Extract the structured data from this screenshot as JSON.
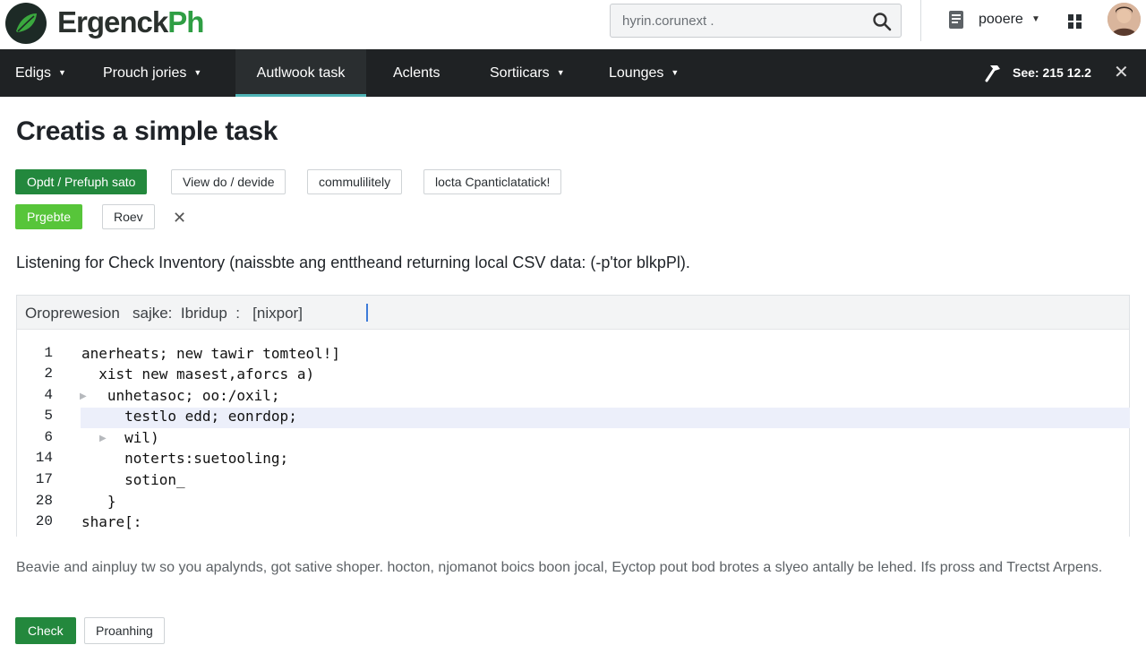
{
  "header": {
    "brand": {
      "main": "Ergenck",
      "accent": "Ph"
    },
    "search": {
      "query": "hyrin.corunext ."
    },
    "user": {
      "name": "pooere"
    }
  },
  "nav": {
    "items": [
      {
        "label": "Edigs",
        "has_menu": true
      },
      {
        "label": "Prouch jories",
        "has_menu": true
      },
      {
        "label": "Autlwook task",
        "has_menu": false,
        "active": true
      },
      {
        "label": "Aclents",
        "has_menu": false
      },
      {
        "label": "Sortiicars",
        "has_menu": true
      },
      {
        "label": "Lounges",
        "has_menu": true
      }
    ],
    "session": "See: 215 12.2"
  },
  "page": {
    "title": "Creatis a simple task",
    "buttons_row1": [
      "Opdt / Prefuph sato",
      "View do / devide",
      "commulilitely",
      "locta  Cpanticlatatick!"
    ],
    "buttons_row2": [
      "Prgebte",
      "Roev"
    ],
    "description": "Listening for Check Inventory (naissbte ang enttheand returning local CSV data: (-p'tor blkpPl).",
    "footer_text": "Beavie and ainpluy tw so you apalynds, got sative shoper. hocton, njomanot boics boon jocal, Eyctop pout bod brotes a slyeo antally be lehed. Ifs pross and Trectst Arpens.",
    "actions": [
      "Check",
      "Proanhing"
    ]
  },
  "editor": {
    "toolbar": "Oroprewesion   sajke:  Ibridup  :   [nixpor]",
    "lines": [
      {
        "num": "1",
        "code": "anerheats; new tawir tomteol!]"
      },
      {
        "num": "2",
        "code": "  xist new masest,aforcs a)"
      },
      {
        "num": "4",
        "code": "   unhetasoc; oo:/oxil;"
      },
      {
        "num": "5",
        "code": "     testlo edd; eonrdop;",
        "highlight": true
      },
      {
        "num": "6",
        "code": "     wil)"
      },
      {
        "num": "14",
        "code": "     noterts:suetooling;"
      },
      {
        "num": "17",
        "code": "     sotion_"
      },
      {
        "num": "28",
        "code": "   }"
      },
      {
        "num": "20",
        "code": "share[:"
      }
    ]
  },
  "colors": {
    "nav_bg": "#1f2224",
    "active_tab_underline": "#4fb3b5",
    "primary_button": "#23883d",
    "secondary_green": "#57c53a",
    "current_line_highlight": "#eceffa"
  },
  "icons": [
    "leaf-logo-icon",
    "search-icon",
    "document-icon",
    "chevron-down-icon",
    "grid-icon",
    "hammer-icon",
    "close-icon",
    "fold-arrow-icon"
  ]
}
